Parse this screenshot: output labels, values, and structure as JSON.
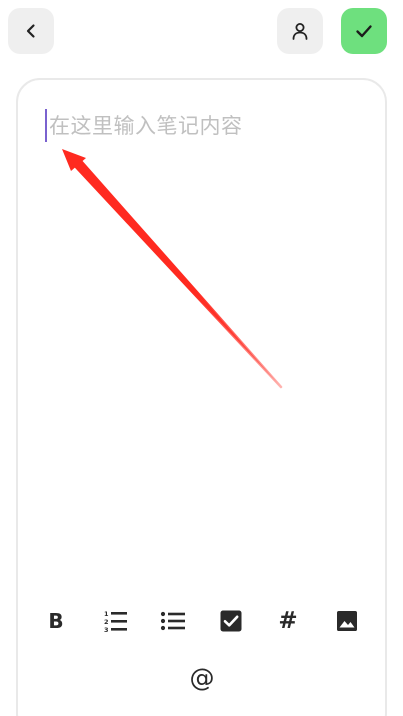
{
  "header": {
    "back_icon": "chevron-left-icon",
    "user_icon": "user-icon",
    "confirm_icon": "check-icon",
    "confirm_color": "#6ee07e"
  },
  "editor": {
    "placeholder": "在这里输入笔记内容",
    "caret_color": "#7a62cf"
  },
  "toolbar": {
    "bold_label": "B",
    "ordered_list_icon": "ordered-list-icon",
    "bullet_list_icon": "bullet-list-icon",
    "checkbox_icon": "checkbox-icon",
    "tag_label": "#",
    "image_icon": "image-icon",
    "mention_label": "@"
  },
  "annotation": {
    "arrow_color": "#ff2a20"
  }
}
